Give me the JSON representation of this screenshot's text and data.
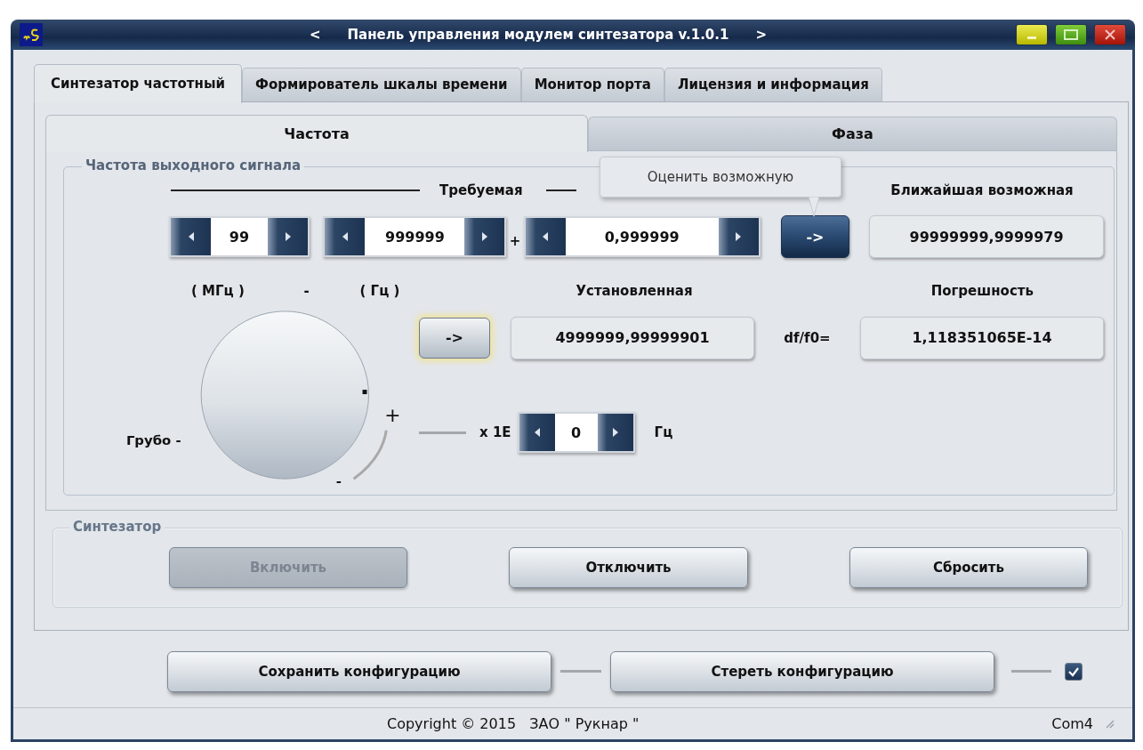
{
  "window": {
    "title_prev": "<",
    "title": "Панель управления модулем синтезатора v.1.0.1",
    "title_next": ">"
  },
  "tabs": [
    {
      "label": "Синтезатор частотный",
      "selected": true
    },
    {
      "label": "Формирователь шкалы времени",
      "selected": false
    },
    {
      "label": "Монитор порта",
      "selected": false
    },
    {
      "label": "Лицензия и информация",
      "selected": false
    }
  ],
  "subtabs": [
    {
      "label": "Частота",
      "selected": true
    },
    {
      "label": "Фаза",
      "selected": false
    }
  ],
  "frequency_group": {
    "title": "Частота выходного сигнала",
    "required_label": "Требуемая",
    "nearest_label": "Ближайшая возможная",
    "spinners": [
      {
        "value": "99"
      },
      {
        "value": "999999"
      },
      {
        "value": "0,999999"
      }
    ],
    "plus": "+",
    "tooltip": "Оценить возможную",
    "estimate_button": {
      "label": "->",
      "hovered": true
    },
    "nearest_value": "99999999,9999979",
    "unit_mhz": "( МГц )",
    "dash": "-",
    "unit_hz": "( Гц )",
    "installed_label": "Установленная",
    "error_label": "Погрешность",
    "set_button": {
      "label": "->",
      "focused": true
    },
    "installed_value": "4999999,99999901",
    "error_prefix": "df/f0=",
    "error_value": "1,118351065E-14",
    "knob": {
      "label": "Грубо -",
      "plus": "+",
      "minus": "-"
    },
    "multiplier_label": "x 1E",
    "exponent": "0",
    "exponent_unit": "Гц"
  },
  "synth_group": {
    "title": "Синтезатор",
    "buttons": [
      {
        "label": "Включить",
        "disabled": true
      },
      {
        "label": "Отключить",
        "disabled": false
      },
      {
        "label": "Сбросить",
        "disabled": false
      }
    ]
  },
  "config_buttons": [
    "Сохранить конфигурацию",
    "Стереть конфигурацию"
  ],
  "config_checkbox": {
    "checked": true
  },
  "status_bar": {
    "copyright": "Copyright © 2015   ЗАО \" Рукнар \"",
    "port": "Com4"
  }
}
